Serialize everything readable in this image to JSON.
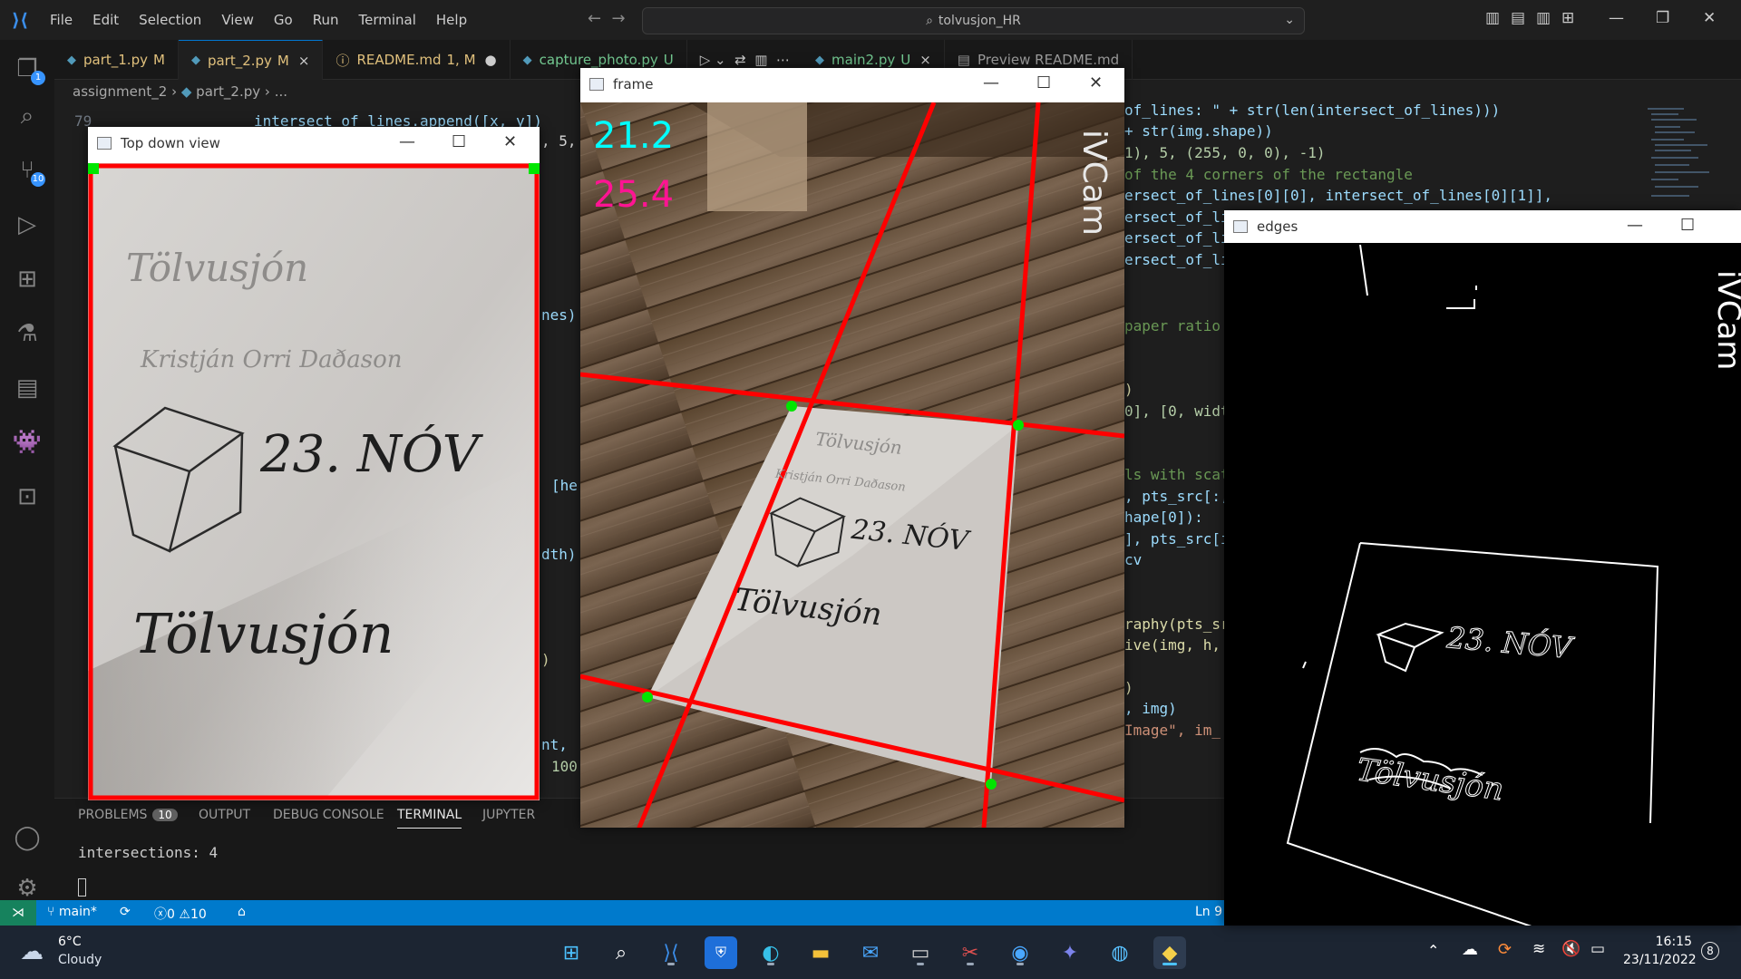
{
  "menu": [
    "File",
    "Edit",
    "Selection",
    "View",
    "Go",
    "Run",
    "Terminal",
    "Help"
  ],
  "search": {
    "text": "tolvusjon_HR"
  },
  "tabs": [
    {
      "label": "part_1.py",
      "flag": "M"
    },
    {
      "label": "part_2.py",
      "flag": "M",
      "close": "×"
    },
    {
      "label": "README.md",
      "flag": "1, M",
      "dot": "●"
    },
    {
      "label": "capture_photo.py",
      "flag": "U"
    },
    {
      "label": "main2.py",
      "flag": "U",
      "close": "×"
    },
    {
      "label": "Preview README.md"
    }
  ],
  "breadcrumb": [
    "assignment_2",
    "part_2.py",
    "..."
  ],
  "activity_badges": {
    "explorer": "1",
    "scm": "10"
  },
  "code": {
    "line_number": "79",
    "line_79": "intersect_of_lines.append([x, y])",
    "left_fragments": [
      ", 5,",
      "nes)",
      "[he",
      "dth)",
      ")",
      "nt, ",
      "100"
    ],
    "right_lines": [
      "of_lines: \" + str(len(intersect_of_lines)))",
      "+ str(img.shape))",
      "1), 5, (255, 0, 0), -1)",
      "of the 4 corners of the rectangle",
      "ersect_of_lines[0][0], intersect_of_lines[0][1]],",
      "ersect_of_li",
      "ersect_of_li",
      "ersect_of_li",
      "paper ratio",
      ")",
      "0], [0, widt",
      "ls with scat",
      ", pts_src[:,",
      "hape[0]):",
      "], pts_src[i",
      "cv",
      "raphy(pts_sr",
      "ive(img, h,",
      ")",
      ", img)",
      "Image\", im_"
    ]
  },
  "panel": {
    "tabs": [
      "PROBLEMS",
      "OUTPUT",
      "DEBUG CONSOLE",
      "TERMINAL",
      "JUPYTER"
    ],
    "problems_count": "10",
    "terminal_output": "intersections: 4"
  },
  "statusbar": {
    "branch": "main*",
    "errors": "0",
    "warnings": "10",
    "position": "Ln 9"
  },
  "windows": {
    "top_down": {
      "title": "Top down view"
    },
    "frame": {
      "title": "frame",
      "fps_a": "21.2",
      "fps_b": "25.4",
      "watermark": "iVCam"
    },
    "edges": {
      "title": "edges",
      "watermark": "iVCam"
    }
  },
  "paper_text": {
    "line1": "Tölvusjón",
    "line2": "Kristján Orri Daðason",
    "date": "23. NÓV",
    "signature": "Tölvusjón"
  },
  "taskbar": {
    "weather_temp": "6°C",
    "weather_desc": "Cloudy",
    "time": "16:15",
    "date": "23/11/2022",
    "notifications": "8"
  },
  "colors": {
    "accent": "#007acc",
    "line_red": "#ff0000",
    "corner_green": "#00e600",
    "fps_cyan": "#00ffff",
    "fps_magenta": "#ff1493"
  }
}
